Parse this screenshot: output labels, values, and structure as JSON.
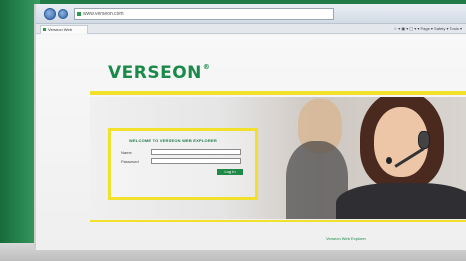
{
  "browser": {
    "address_url": "www.verseon.com",
    "tab_label": "Verseon Web Explorer",
    "toolbar_controls": "☆ ▾  ▣ ▾  ▢ ▾  ▾  Page ▾  Safety ▾  Tools ▾"
  },
  "page": {
    "logo_text": "VERSEON",
    "logo_mark": "®",
    "login": {
      "welcome_heading": "WELCOME TO VERSEON WEB EXPLORER",
      "username_label": "Name",
      "password_label": "Password",
      "button_label": "Log In"
    },
    "footer_link": "Verseon Web Explorer"
  },
  "colors": {
    "brand_green": "#1a8a4a",
    "accent_yellow": "#f2e12b"
  }
}
